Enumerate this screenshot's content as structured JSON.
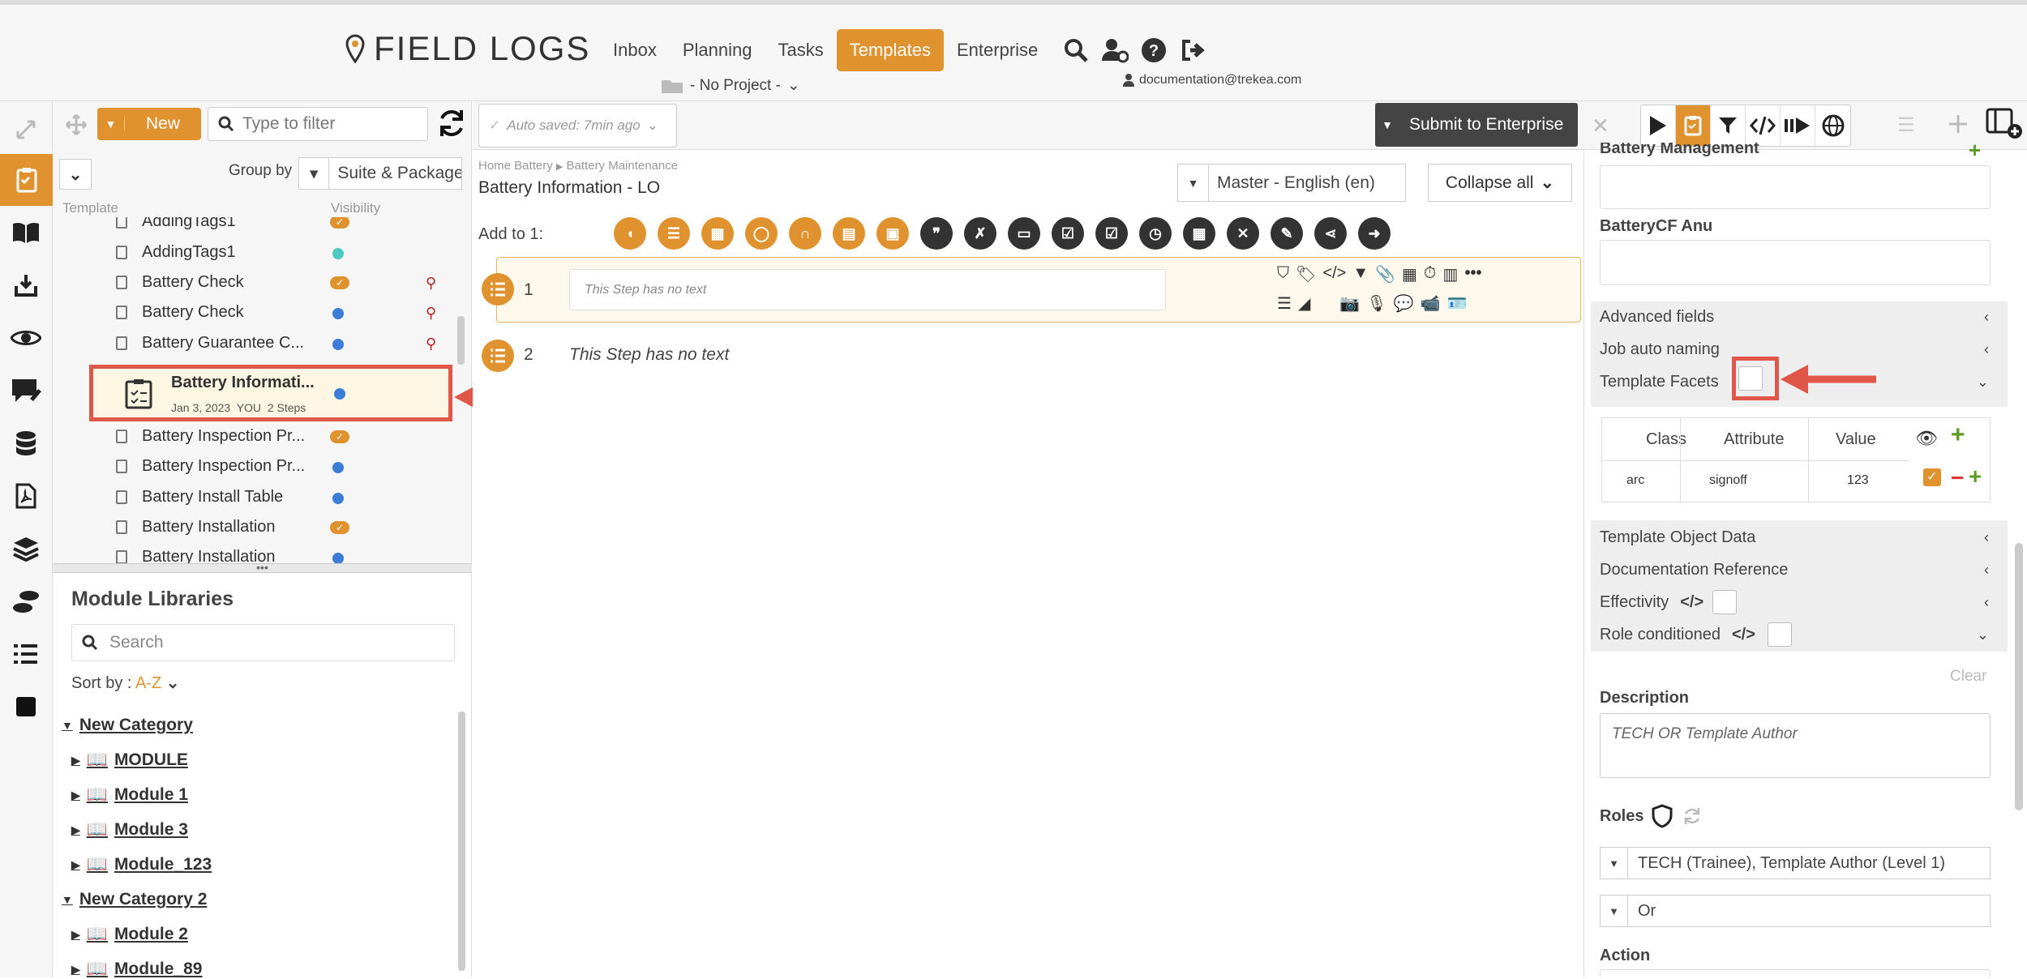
{
  "app": {
    "logo_text": "FIELD LOGS"
  },
  "nav": {
    "items": [
      "Inbox",
      "Planning",
      "Tasks",
      "Templates",
      "Enterprise"
    ],
    "active_index": 3,
    "project_label": "- No Project -",
    "user_email": "documentation@trekea.com"
  },
  "templates_panel": {
    "new_label": "New",
    "filter_placeholder": "Type to filter",
    "group_by_label": "Group by",
    "group_by_value": "Suite & Package",
    "col_template": "Template",
    "col_visibility": "Visibility",
    "rows": [
      {
        "name": "AddingTags1",
        "vis": "check"
      },
      {
        "name": "AddingTags1",
        "vis": "teal"
      },
      {
        "name": "Battery Check",
        "vis": "check",
        "pinned": true
      },
      {
        "name": "Battery Check",
        "vis": "blue",
        "pinned": true
      },
      {
        "name": "Battery Guarantee C...",
        "vis": "blue",
        "pinned": true
      },
      {
        "name": "Battery Inspection Pr...",
        "vis": "check"
      },
      {
        "name": "Battery Inspection Pr...",
        "vis": "blue"
      },
      {
        "name": "Battery Install Table",
        "vis": "blue"
      },
      {
        "name": "Battery Installation",
        "vis": "check"
      },
      {
        "name": "Battery Installation",
        "vis": "blue"
      }
    ],
    "selected": {
      "name": "Battery Informati...",
      "meta": "Jan 3, 2023  YOU  2 Steps"
    }
  },
  "modules": {
    "title": "Module Libraries",
    "search_placeholder": "Search",
    "sort_label": "Sort by :",
    "sort_value": "A-Z",
    "tree": [
      {
        "label": "New Category",
        "level": 0,
        "type": "category"
      },
      {
        "label": "MODULE",
        "level": 1,
        "type": "module"
      },
      {
        "label": "Module 1",
        "level": 1,
        "type": "module"
      },
      {
        "label": "Module 3",
        "level": 1,
        "type": "module"
      },
      {
        "label": "Module_123",
        "level": 1,
        "type": "module"
      },
      {
        "label": "New Category 2",
        "level": 0,
        "type": "category"
      },
      {
        "label": "Module 2",
        "level": 1,
        "type": "module"
      },
      {
        "label": "Module_89",
        "level": 1,
        "type": "module"
      }
    ]
  },
  "editor": {
    "autosave": "Auto saved: 7min ago",
    "submit_label": "Submit to Enterprise",
    "breadcrumb_1": "Home Battery",
    "breadcrumb_2": "Battery Maintenance",
    "title": "Battery Information - LO",
    "language": "Master - English (en)",
    "collapse_label": "Collapse all",
    "add_to_label": "Add to 1:",
    "steps": [
      {
        "index": "1",
        "placeholder": "This Step has no text"
      },
      {
        "index": "2",
        "text": "This Step has no text"
      }
    ]
  },
  "right_panel": {
    "battery_management_label": "Battery Management",
    "batterycf_label": "BatteryCF Anu",
    "advanced_fields": "Advanced fields",
    "job_auto_naming": "Job auto naming",
    "template_facets": "Template Facets",
    "facets_headers": {
      "class": "Class",
      "attribute": "Attribute",
      "value": "Value"
    },
    "facets_row": {
      "class": "arc",
      "attribute": "signoff",
      "value": "123"
    },
    "template_object_data": "Template Object Data",
    "documentation_reference": "Documentation Reference",
    "effectivity": "Effectivity",
    "role_conditioned": "Role conditioned",
    "clear_label": "Clear",
    "description_label": "Description",
    "description_value": "TECH OR Template Author",
    "roles_label": "Roles",
    "roles_value": "TECH (Trainee), Template Author (Level 1)",
    "roles_operator": "Or",
    "action_label": "Action"
  },
  "colors": {
    "accent": "#e0922f",
    "highlight": "#e0574a",
    "blue_dot": "#3b7dd8",
    "teal_dot": "#4ec9c0"
  }
}
